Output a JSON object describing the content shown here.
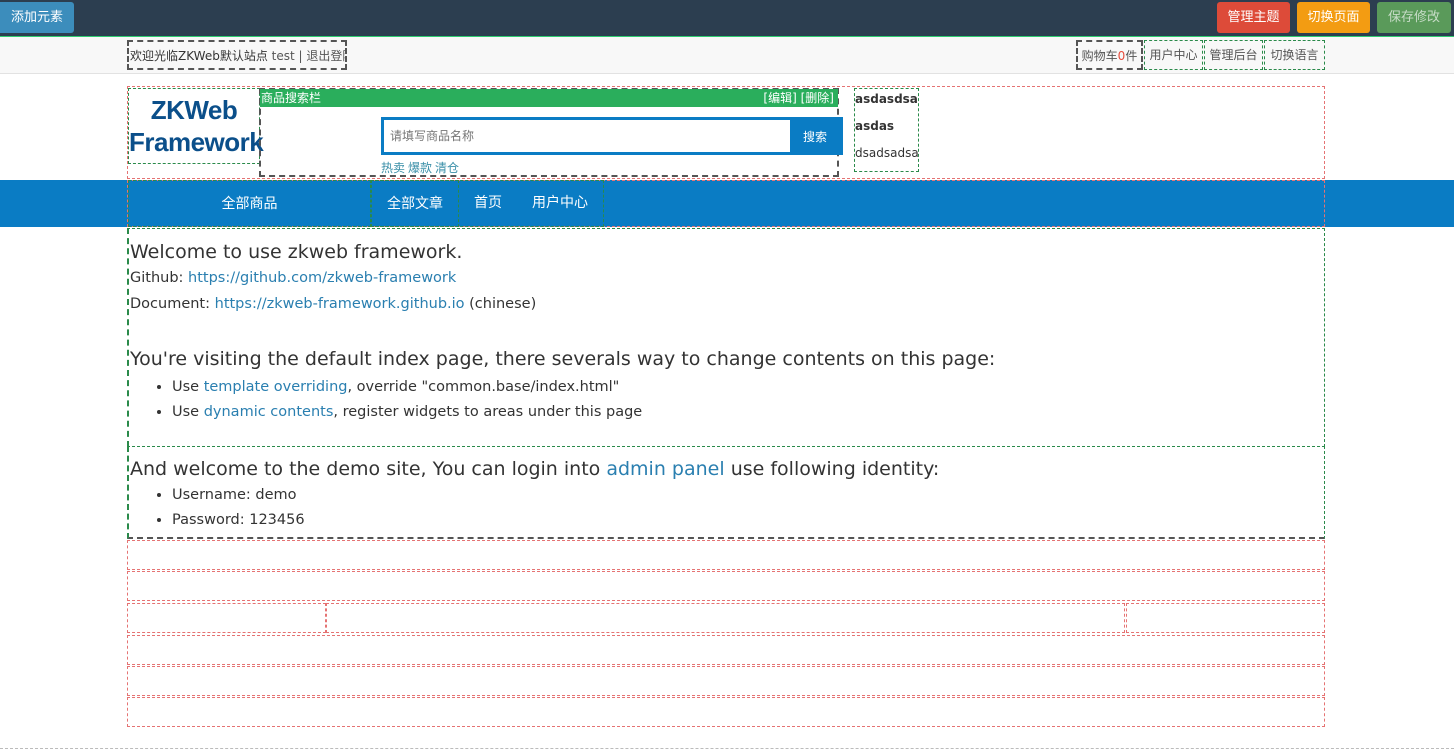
{
  "editor": {
    "add_element": "添加元素",
    "manage_theme": "管理主题",
    "switch_page": "切换页面",
    "save_changes": "保存修改"
  },
  "header": {
    "welcome_prefix": "欢迎光临ZKWeb默认站点",
    "username": "test",
    "separator": "|",
    "logout": "退出登陆",
    "cart_label": "购物车",
    "cart_count": "0",
    "cart_unit": "件",
    "user_center": "用户中心",
    "admin_panel": "管理后台",
    "switch_language": "切换语言"
  },
  "logo": {
    "line1": "ZKWeb",
    "line2": "Framework"
  },
  "search": {
    "widget_title": "商品搜索栏",
    "edit": "[编辑]",
    "delete": "[删除]",
    "placeholder": "请填写商品名称",
    "button": "搜索",
    "hot_keywords": [
      "热卖",
      "爆款",
      "清仓"
    ]
  },
  "side_text": [
    "asdasdsad",
    "asdas",
    "dsadsadsa"
  ],
  "nav": {
    "all_products": "全部商品",
    "items": [
      "全部文章",
      "首页",
      "用户中心"
    ]
  },
  "content": {
    "welcome_heading": "Welcome to use zkweb framework.",
    "github_label": "Github:",
    "github_url": "https://github.com/zkweb-framework",
    "document_label": "Document:",
    "document_url": "https://zkweb-framework.github.io",
    "document_suffix": "(chinese)",
    "visiting_heading": "You're visiting the default index page, there severals way to change contents on this page:",
    "bullet1_prefix": "Use",
    "bullet1_link": "template overriding",
    "bullet1_suffix": ", override \"common.base/index.html\"",
    "bullet2_prefix": "Use",
    "bullet2_link": "dynamic contents",
    "bullet2_suffix": ", register widgets to areas under this page",
    "demo_heading_prefix": "And welcome to the demo site, You can login into",
    "demo_heading_link": "admin panel",
    "demo_heading_suffix": "use following identity:",
    "username_line": "Username: demo",
    "password_line": "Password: 123456"
  }
}
